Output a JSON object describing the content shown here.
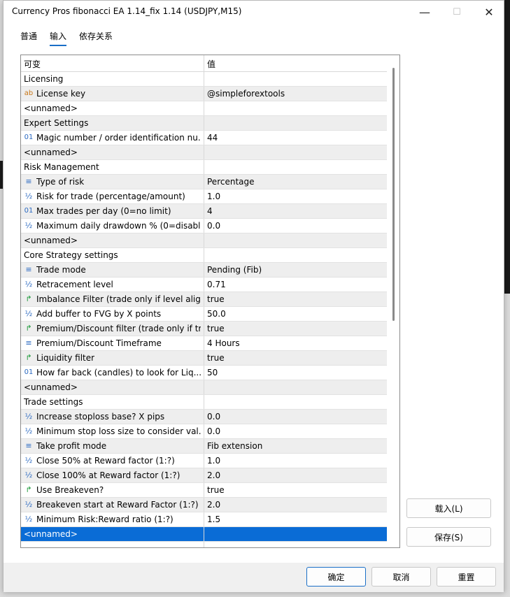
{
  "window": {
    "title": "Currency Pros fibonacci EA 1.14_fix 1.14 (USDJPY,M15)",
    "minimize": "—",
    "maximize": "☐",
    "close": "✕"
  },
  "tabs": [
    "普通",
    "输入",
    "依存关系"
  ],
  "active_tab": "输入",
  "grid": {
    "col_variable": "可变",
    "col_value": "值",
    "rows": [
      {
        "icon": "",
        "name": "Licensing",
        "value": ""
      },
      {
        "icon": "ab",
        "name": "License key",
        "value": "@simpleforextools"
      },
      {
        "icon": "",
        "name": "<unnamed>",
        "value": ""
      },
      {
        "icon": "",
        "name": "Expert Settings",
        "value": ""
      },
      {
        "icon": "01",
        "name": "Magic number / order identification nu...",
        "value": "44"
      },
      {
        "icon": "",
        "name": "<unnamed>",
        "value": ""
      },
      {
        "icon": "",
        "name": "Risk Management",
        "value": ""
      },
      {
        "icon": "≡",
        "name": "Type of risk",
        "value": "Percentage"
      },
      {
        "icon": "½",
        "name": "Risk for trade (percentage/amount)",
        "value": "1.0"
      },
      {
        "icon": "01",
        "name": "Max trades per day (0=no limit)",
        "value": "4"
      },
      {
        "icon": "½",
        "name": "Maximum daily drawdown % (0=disabl...",
        "value": "0.0"
      },
      {
        "icon": "",
        "name": "<unnamed>",
        "value": ""
      },
      {
        "icon": "",
        "name": "Core Strategy settings",
        "value": ""
      },
      {
        "icon": "≡",
        "name": "Trade mode",
        "value": "Pending (Fib)"
      },
      {
        "icon": "½",
        "name": "Retracement level",
        "value": "0.71"
      },
      {
        "icon": "↱",
        "name": "Imbalance Filter (trade only if level alig...",
        "value": "true"
      },
      {
        "icon": "½",
        "name": "Add buffer to FVG by X points",
        "value": "50.0"
      },
      {
        "icon": "↱",
        "name": "Premium/Discount filter (trade only if tr...",
        "value": "true"
      },
      {
        "icon": "≡",
        "name": "Premium/Discount Timeframe",
        "value": "4 Hours"
      },
      {
        "icon": "↱",
        "name": "Liquidity filter",
        "value": "true"
      },
      {
        "icon": "01",
        "name": "How far back (candles) to look for Liq...",
        "value": "50"
      },
      {
        "icon": "",
        "name": "<unnamed>",
        "value": ""
      },
      {
        "icon": "",
        "name": "Trade settings",
        "value": ""
      },
      {
        "icon": "½",
        "name": "Increase stoploss base? X pips",
        "value": "0.0"
      },
      {
        "icon": "½",
        "name": "Minimum stop loss size to consider val...",
        "value": "0.0"
      },
      {
        "icon": "≡",
        "name": "Take profit mode",
        "value": "Fib extension"
      },
      {
        "icon": "½",
        "name": "Close 50% at Reward factor (1:?)",
        "value": "1.0"
      },
      {
        "icon": "½",
        "name": "Close 100% at Reward factor (1:?)",
        "value": "2.0"
      },
      {
        "icon": "↱",
        "name": "Use Breakeven?",
        "value": "true"
      },
      {
        "icon": "½",
        "name": "Breakeven start at Reward Factor (1:?)",
        "value": "2.0"
      },
      {
        "icon": "½",
        "name": "Minimum Risk:Reward ratio (1:?)",
        "value": "1.5"
      },
      {
        "icon": "",
        "name": "<unnamed>",
        "value": ""
      }
    ],
    "selected_row": 31
  },
  "side_buttons": {
    "load": "载入(L)",
    "save": "保存(S)"
  },
  "bottom_buttons": {
    "ok": "确定",
    "cancel": "取消",
    "reset": "重置"
  },
  "colors": {
    "selection": "#0a6cd6",
    "accent": "#1a6fc7",
    "bool_icon": "#1c9a3a",
    "string_icon": "#c8781a"
  }
}
